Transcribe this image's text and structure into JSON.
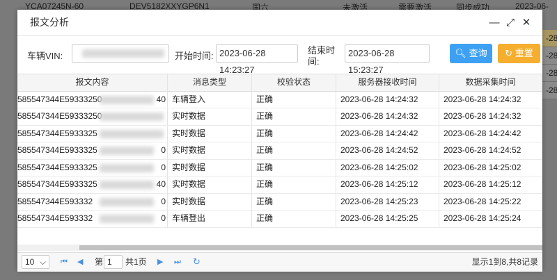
{
  "background": {
    "row1": [
      "YCA07245N-60",
      "DEV5182XXYGP6N1",
      "国六",
      "未激活",
      "需要激活",
      "同步成功",
      "2023-06-"
    ],
    "right_items": [
      "-28",
      "-28",
      "-28",
      "-28"
    ]
  },
  "modal": {
    "title": "报文分析",
    "minimize_icon": "—",
    "maximize_icon": "⤢",
    "close_icon": "✕"
  },
  "filter": {
    "vin_label": "车辆VIN:",
    "vin_value": "",
    "start_label": "开始时间:",
    "start_value": "2023-06-28 14:23:27",
    "end_label_1": "结束时",
    "end_label_2": "间:",
    "end_value": "2023-06-28 15:23:27",
    "query_label": "查询",
    "reset_label": "重置"
  },
  "table": {
    "headers": [
      "报文内容",
      "消息类型",
      "校验状态",
      "服务器接收时间",
      "数据采集时间"
    ],
    "rows": [
      {
        "content": "585547344E59333250",
        "tail": "40",
        "type": "车辆登入",
        "status": "正确",
        "server_time": "2023-06-28 14:24:32",
        "collect_time": "2023-06-28 14:24:32"
      },
      {
        "content": "585547344E59333250",
        "tail": "",
        "type": "实时数据",
        "status": "正确",
        "server_time": "2023-06-28 14:24:32",
        "collect_time": "2023-06-28 14:24:32"
      },
      {
        "content": "585547344E5933325",
        "tail": "",
        "type": "实时数据",
        "status": "正确",
        "server_time": "2023-06-28 14:24:42",
        "collect_time": "2023-06-28 14:24:42"
      },
      {
        "content": "585547344E5933325",
        "tail": "0",
        "type": "实时数据",
        "status": "正确",
        "server_time": "2023-06-28 14:24:52",
        "collect_time": "2023-06-28 14:24:52"
      },
      {
        "content": "585547344E5933325",
        "tail": "0",
        "type": "实时数据",
        "status": "正确",
        "server_time": "2023-06-28 14:25:02",
        "collect_time": "2023-06-28 14:25:02"
      },
      {
        "content": "585547344E5933325",
        "tail": "40",
        "type": "实时数据",
        "status": "正确",
        "server_time": "2023-06-28 14:25:12",
        "collect_time": "2023-06-28 14:25:12"
      },
      {
        "content": "585547344E593332",
        "tail": "0",
        "type": "实时数据",
        "status": "正确",
        "server_time": "2023-06-28 14:25:23",
        "collect_time": "2023-06-28 14:25:22"
      },
      {
        "content": "585547344E593332",
        "tail": "0",
        "type": "车辆登出",
        "status": "正确",
        "server_time": "2023-06-28 14:25:25",
        "collect_time": "2023-06-28 14:25:24"
      }
    ]
  },
  "pager": {
    "page_size": "10",
    "page_prefix": "第",
    "page_value": "1",
    "page_total": "共1页",
    "summary": "显示1到8,共8记录"
  }
}
